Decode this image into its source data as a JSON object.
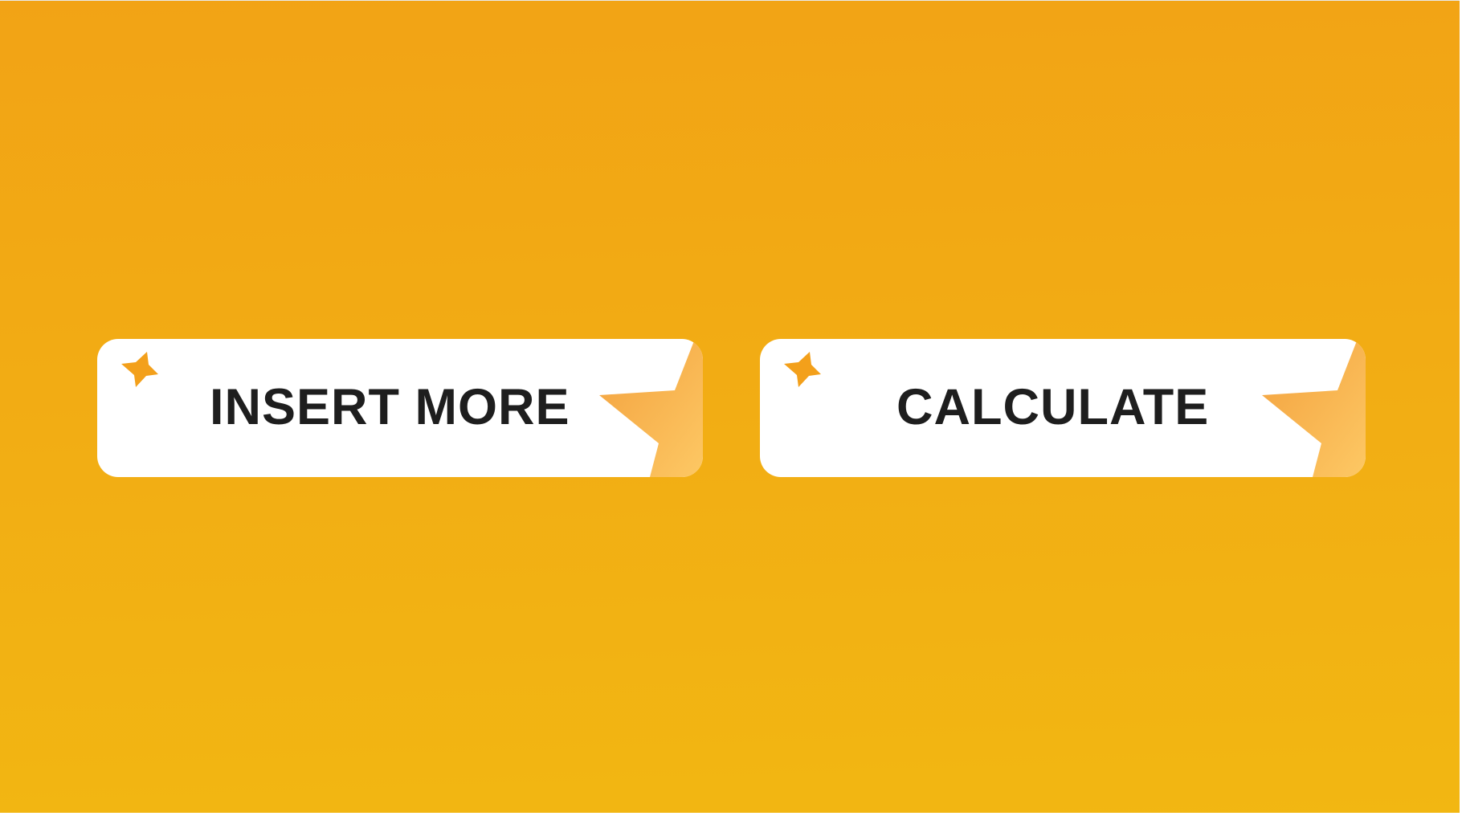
{
  "buttons": [
    {
      "label": "INSERT MORE",
      "icon": "sparkle-icon"
    },
    {
      "label": "CALCULATE",
      "icon": "sparkle-icon"
    }
  ],
  "colors": {
    "background_top": "#f2a315",
    "background_bottom": "#f2b712",
    "button_fill": "#ffffff",
    "label_text": "#1e1e1e",
    "sparkle": "#f3a01b",
    "corner_light": "#fdc864",
    "corner_dark": "#f3a13e"
  }
}
